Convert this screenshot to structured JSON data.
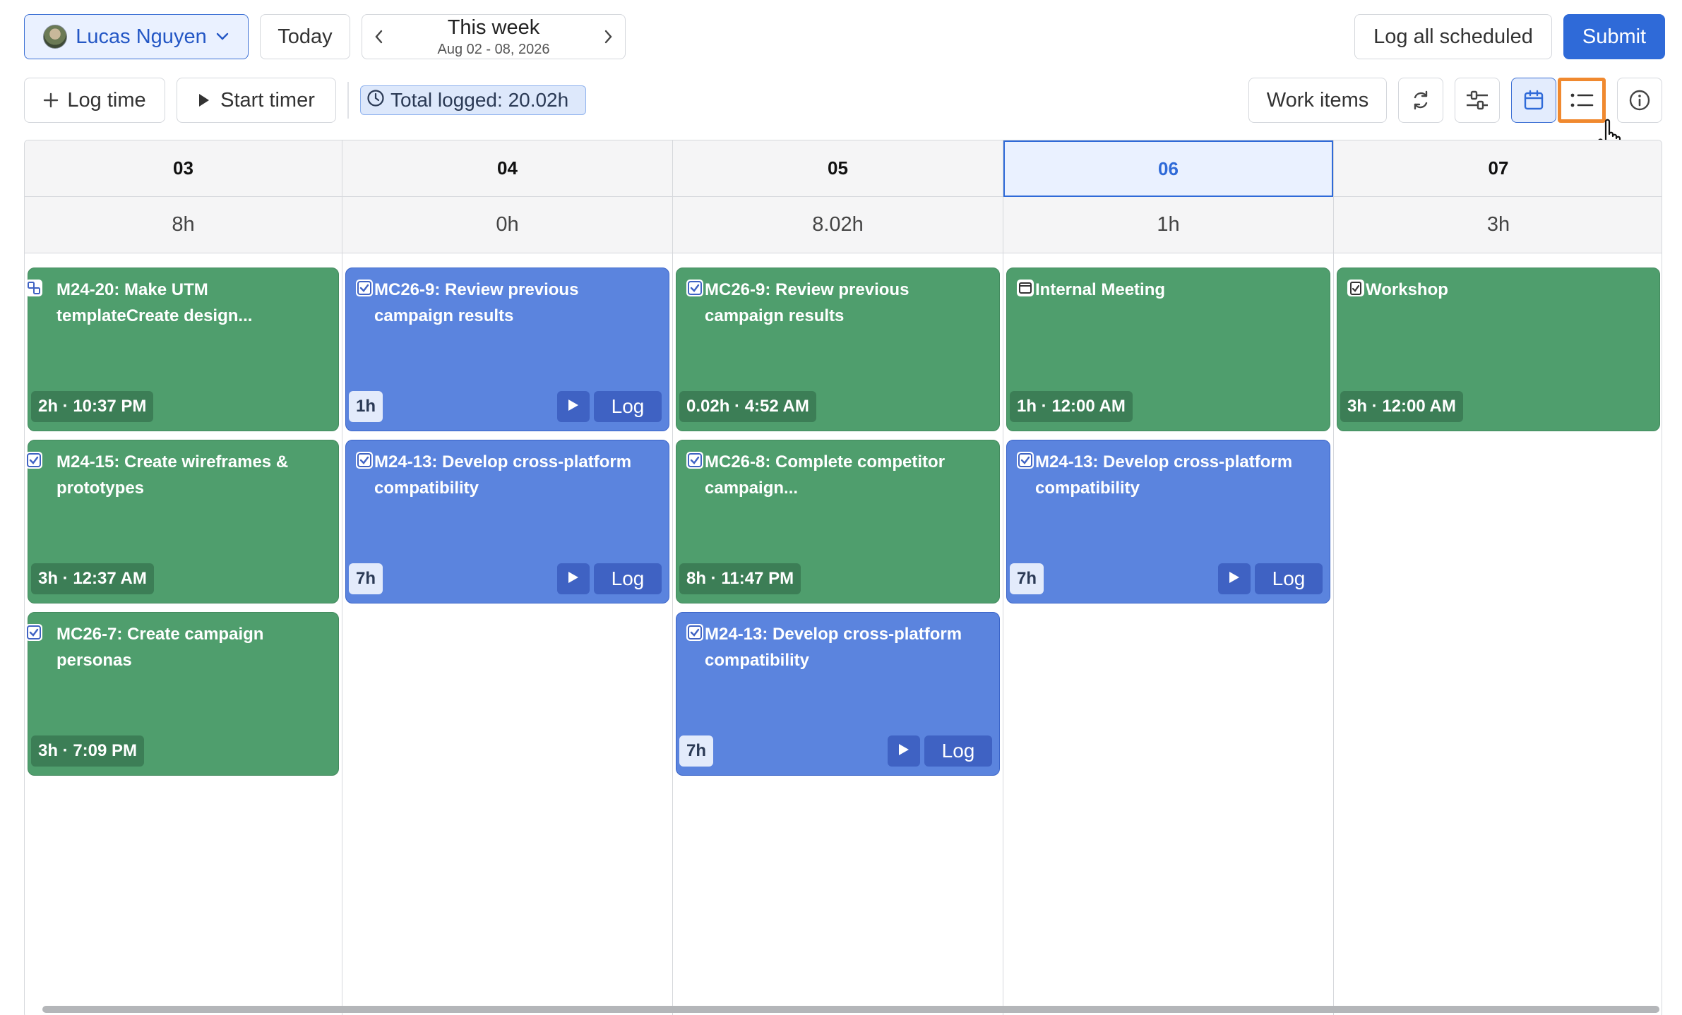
{
  "header": {
    "user_name": "Lucas Nguyen",
    "today_label": "Today",
    "week_title": "This week",
    "week_range": "Aug 02 - 08, 2026",
    "log_all_label": "Log all scheduled",
    "submit_label": "Submit"
  },
  "toolbar": {
    "log_time_label": "Log time",
    "start_timer_label": "Start timer",
    "total_logged": "Total logged: 20.02h",
    "work_items_label": "Work items"
  },
  "colors": {
    "accent": "#2f6ad8",
    "scheduled_green": "#4f9e6d",
    "task_blue": "#5b84de",
    "highlight_orange": "#f0892f"
  },
  "days": [
    {
      "date": "03",
      "total": "8h",
      "today": false,
      "entries": [
        {
          "icon": "subtask-icon",
          "title": "M24-20: Make UTM templateCreate design...",
          "meta": "2h · 10:37 PM",
          "color": "green",
          "actions": false
        },
        {
          "icon": "checkbox-icon",
          "title": "M24-15: Create wireframes & prototypes",
          "meta": "3h · 12:37 AM",
          "color": "green",
          "actions": false
        },
        {
          "icon": "checkbox-icon",
          "title": "MC26-7: Create campaign personas",
          "meta": "3h · 7:09 PM",
          "color": "green",
          "actions": false
        }
      ]
    },
    {
      "date": "04",
      "total": "0h",
      "today": false,
      "entries": [
        {
          "icon": "checkbox-icon",
          "title": "MC26-9: Review previous campaign results",
          "meta": "1h",
          "color": "blue",
          "actions": true,
          "log_label": "Log"
        },
        {
          "icon": "checkbox-icon",
          "title": "M24-13: Develop cross-platform compatibility",
          "meta": "7h",
          "color": "blue",
          "actions": true,
          "log_label": "Log"
        }
      ]
    },
    {
      "date": "05",
      "total": "8.02h",
      "today": false,
      "entries": [
        {
          "icon": "checkbox-icon",
          "title": "MC26-9: Review previous campaign results",
          "meta": "0.02h · 4:52 AM",
          "color": "green",
          "actions": false
        },
        {
          "icon": "checkbox-icon",
          "title": "MC26-8: Complete competitor campaign...",
          "meta": "8h · 11:47 PM",
          "color": "green",
          "actions": false
        },
        {
          "icon": "checkbox-icon",
          "title": "M24-13: Develop cross-platform compatibility",
          "meta": "7h",
          "color": "blue",
          "actions": true,
          "log_label": "Log"
        }
      ]
    },
    {
      "date": "06",
      "total": "1h",
      "today": true,
      "entries": [
        {
          "icon": "calendar-icon",
          "title": "Internal Meeting",
          "meta": "1h · 12:00 AM",
          "color": "green",
          "actions": false
        },
        {
          "icon": "checkbox-icon",
          "title": "M24-13: Develop cross-platform compatibility",
          "meta": "7h",
          "color": "blue",
          "actions": true,
          "log_label": "Log"
        }
      ]
    },
    {
      "date": "07",
      "total": "3h",
      "today": false,
      "entries": [
        {
          "icon": "clipboard-icon",
          "title": "Workshop",
          "meta": "3h · 12:00 AM",
          "color": "green",
          "actions": false
        }
      ]
    }
  ]
}
